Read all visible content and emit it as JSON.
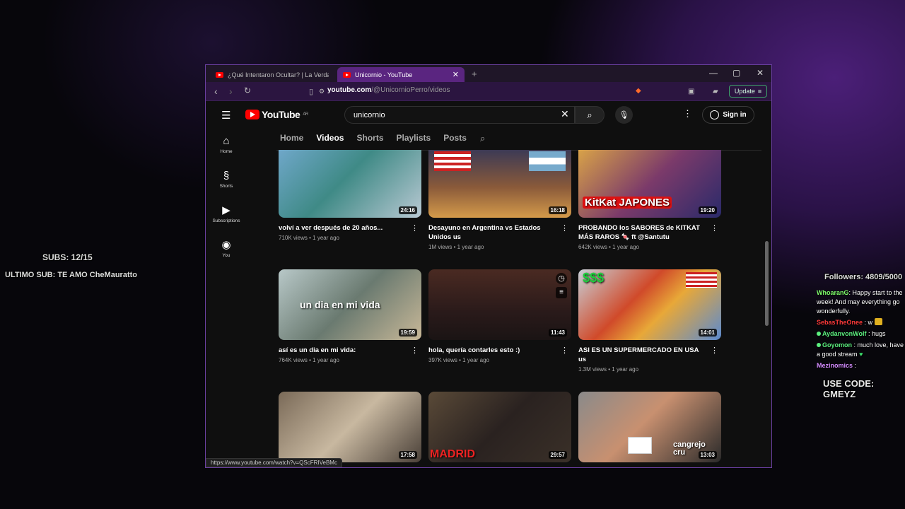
{
  "overlay": {
    "subs": "SUBS: 12/15",
    "ultimo": "ULTIMO SUB: TE AMO CheMauratto",
    "followers": "Followers: 4809/5000",
    "usecode": "USE CODE: GMEYZ"
  },
  "chat": [
    {
      "user": "WhoaranG",
      "color": "#7fff6a",
      "text": ": Happy start to the week! And may everything go wonderfully.",
      "badge": ""
    },
    {
      "user": "SebasTheOnee",
      "color": "#ff3a3a",
      "text": ": w",
      "badge": "emote"
    },
    {
      "user": "AydanvonWolf",
      "color": "#5cf07f",
      "text": ": hugs",
      "badge": "dot"
    },
    {
      "user": "Goyomon",
      "color": "#5cf07f",
      "text": ": much love, have a good stream",
      "badge": "dot"
    },
    {
      "user": "Mezinomics",
      "color": "#d48cff",
      "text": ":",
      "badge": ""
    }
  ],
  "browser": {
    "tabs": [
      {
        "title": "¿Qué Intentaron Ocultar? | La Verdad"
      },
      {
        "title": "Unicornio - YouTube"
      }
    ],
    "url_host": "youtube.com",
    "url_path": "/@UnicornioPerro/videos",
    "update_label": "Update",
    "status_url": "https://www.youtube.com/watch?v=QScFRIVeBMc"
  },
  "youtube": {
    "country": "AR",
    "logo_text": "YouTube",
    "search_value": "unicornio",
    "sign_in": "Sign in",
    "sidebar": [
      {
        "label": "Home",
        "icon": "home-icon"
      },
      {
        "label": "Shorts",
        "icon": "shorts-icon"
      },
      {
        "label": "Subscriptions",
        "icon": "subscriptions-icon"
      },
      {
        "label": "You",
        "icon": "you-icon"
      }
    ],
    "channel_tabs": [
      "Home",
      "Videos",
      "Shorts",
      "Playlists",
      "Posts"
    ],
    "videos": [
      {
        "title": "volví a ver después de 20 años...",
        "views": "710K views",
        "age": "1 year ago",
        "duration": "24:16",
        "overlay": ""
      },
      {
        "title": "Desayuno en Argentina vs Estados Unidos us",
        "views": "1M views",
        "age": "1 year ago",
        "duration": "16:18",
        "overlay": ""
      },
      {
        "title": "PROBANDO los SABORES de KITKAT MÁS RAROS 🍬 ft @Santutu",
        "views": "642K views",
        "age": "1 year ago",
        "duration": "19:20",
        "overlay": "KitKat JAPONES"
      },
      {
        "title": "así es un dia en mi vida:",
        "views": "764K views",
        "age": "1 year ago",
        "duration": "19:59",
        "overlay": "un dia en mi vida"
      },
      {
        "title": "hola, quería contarles esto :)",
        "views": "397K views",
        "age": "1 year ago",
        "duration": "11:43",
        "overlay": ""
      },
      {
        "title": "ASI ES UN SUPERMERCADO EN USA us",
        "views": "1.3M views",
        "age": "1 year ago",
        "duration": "14:01",
        "overlay": "$$$"
      },
      {
        "title": "",
        "views": "",
        "age": "",
        "duration": "17:58",
        "overlay": ""
      },
      {
        "title": "",
        "views": "",
        "age": "",
        "duration": "29:57",
        "overlay": "MADRID"
      },
      {
        "title": "",
        "views": "",
        "age": "",
        "duration": "13:03",
        "overlay": "cangrejo cru"
      }
    ]
  }
}
